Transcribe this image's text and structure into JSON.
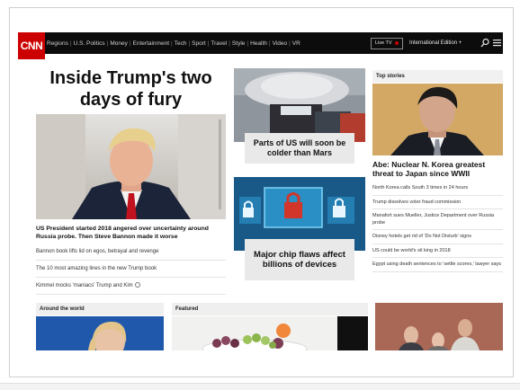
{
  "nav": {
    "logo": "CNN",
    "items": [
      "Regions",
      "U.S. Politics",
      "Money",
      "Entertainment",
      "Tech",
      "Sport",
      "Travel",
      "Style",
      "Health",
      "Video",
      "VR"
    ],
    "live_tv": "Live TV",
    "edition": "International Edition +"
  },
  "left": {
    "headline": "Inside Trump's two days of fury",
    "caption": "US President started 2018 angered over uncertainty around Russia probe. Then Steve Bannon made it worse",
    "links": [
      "Bannon book lifts lid on egos, betrayal and revenge",
      "The 10 most amazing lines in the new Trump book",
      "Kimmel mocks 'maniacs' Trump and Kim"
    ]
  },
  "middle": {
    "story1": "Parts of US will soon be colder than Mars",
    "story2": "Major chip flaws affect billions of devices"
  },
  "right": {
    "section": "Top stories",
    "headline": "Abe: Nuclear N. Korea greatest threat to Japan since WWII",
    "links": [
      "North Korea calls South 3 times in 24 hours",
      "Trump dissolves voter fraud commission",
      "Manafort sues Mueller, Justice Department over Russia probe",
      "Disney hotels get rid of 'Do Not Disturb' signs",
      "US could be world's oil king in 2018",
      "Egypt using death sentences to 'settle scores,' lawyer says"
    ]
  },
  "lower": {
    "world": "Around the world",
    "featured": "Featured"
  },
  "colors": {
    "brand": "#cc0000",
    "nav_bg": "#0c0c0c"
  }
}
